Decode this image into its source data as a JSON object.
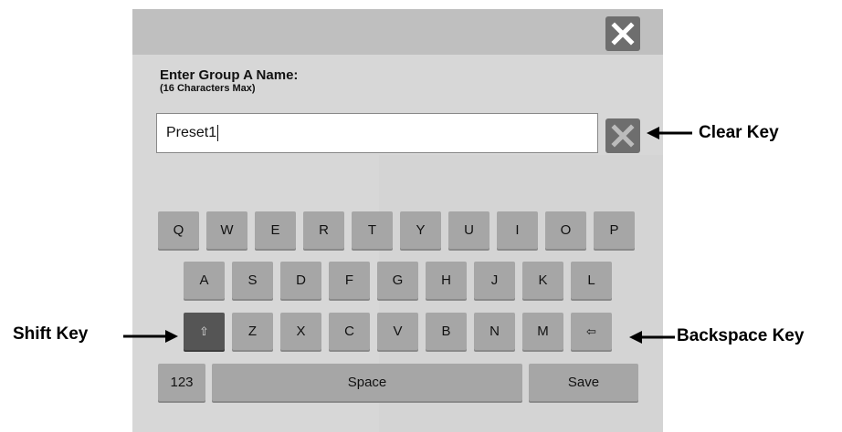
{
  "dialog": {
    "close_icon": "close-x-icon",
    "prompt_title": "Enter Group A Name:",
    "prompt_subtitle": "(16 Characters Max)",
    "input_value": "Preset1",
    "clear_icon": "clear-x-icon"
  },
  "keyboard": {
    "row1": [
      "Q",
      "W",
      "E",
      "R",
      "T",
      "Y",
      "U",
      "I",
      "O",
      "P"
    ],
    "row2": [
      "A",
      "S",
      "D",
      "F",
      "G",
      "H",
      "J",
      "K",
      "L"
    ],
    "row3": [
      "⇧",
      "Z",
      "X",
      "C",
      "V",
      "B",
      "N",
      "M",
      "⇦"
    ],
    "row4": [
      "123",
      "Space",
      "Save"
    ]
  },
  "callouts": {
    "clear_key": "Clear Key",
    "shift_key": "Shift Key",
    "backspace_key": "Backspace Key"
  },
  "colors": {
    "panel_bg": "#d7d7d7",
    "titlebar_bg": "#bfbfbf",
    "key_bg": "#a6a6a6",
    "shift_key_bg": "#555555",
    "close_btn_bg": "#6e6e6e"
  }
}
